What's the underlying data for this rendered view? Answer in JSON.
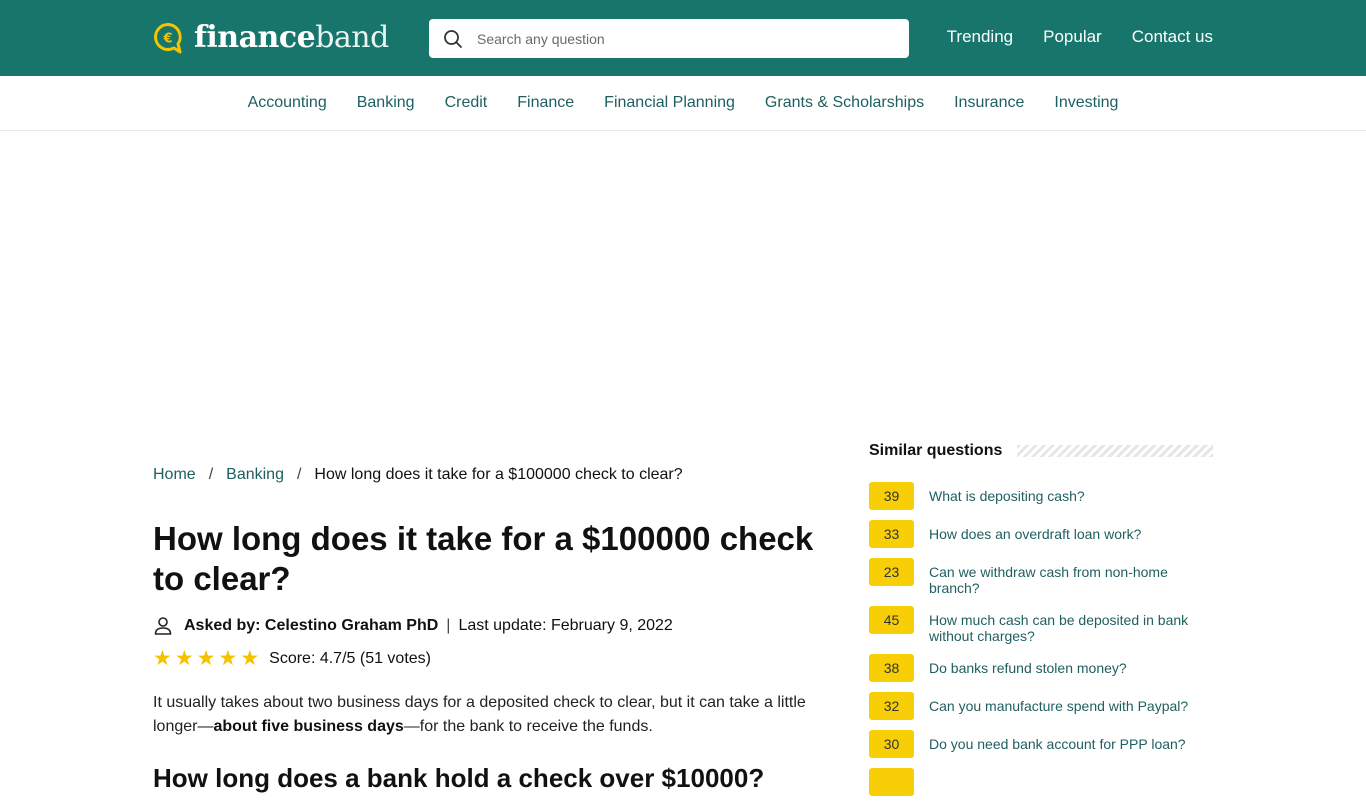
{
  "header": {
    "logo": {
      "part1": "finance",
      "part2": "band",
      "accent": "#f2c500"
    },
    "search": {
      "placeholder": "Search any question",
      "value": ""
    },
    "links": [
      {
        "label": "Trending"
      },
      {
        "label": "Popular"
      },
      {
        "label": "Contact us"
      }
    ],
    "bg_color": "#17756b"
  },
  "categories": [
    {
      "label": "Accounting"
    },
    {
      "label": "Banking"
    },
    {
      "label": "Credit"
    },
    {
      "label": "Finance"
    },
    {
      "label": "Financial Planning"
    },
    {
      "label": "Grants & Scholarships"
    },
    {
      "label": "Insurance"
    },
    {
      "label": "Investing"
    }
  ],
  "breadcrumb": {
    "items": [
      {
        "label": "Home"
      },
      {
        "label": "Banking"
      }
    ],
    "separator": "/",
    "current": "How long does it take for a $100000 check to clear?"
  },
  "article": {
    "title": "How long does it take for a $100000 check to clear?",
    "asked_by": "Asked by: Celestino Graham PhD",
    "separator": "|",
    "last_update": "Last update: February 9, 2022",
    "rating": {
      "stars": 5,
      "score_text": "Score: 4.7/5 (51 votes)",
      "score": 4.7,
      "max": 5,
      "votes": 51
    },
    "answer": {
      "pre": "It usually takes about two business days for a deposited check to clear, but it can take a little longer—",
      "bold": "about five business days",
      "post": "—for the bank to receive the funds."
    },
    "next_heading": "How long does a bank hold a check over $10000?"
  },
  "sidebar": {
    "title": "Similar questions",
    "questions": [
      {
        "count": "39",
        "text": "What is depositing cash?"
      },
      {
        "count": "33",
        "text": "How does an overdraft loan work?"
      },
      {
        "count": "23",
        "text": "Can we withdraw cash from non-home branch?"
      },
      {
        "count": "45",
        "text": "How much cash can be deposited in bank without charges?"
      },
      {
        "count": "38",
        "text": "Do banks refund stolen money?"
      },
      {
        "count": "32",
        "text": "Can you manufacture spend with Paypal?"
      },
      {
        "count": "30",
        "text": "Do you need bank account for PPP loan?"
      },
      {
        "count": "",
        "text": ""
      }
    ],
    "badge_color": "#f8cf06"
  }
}
